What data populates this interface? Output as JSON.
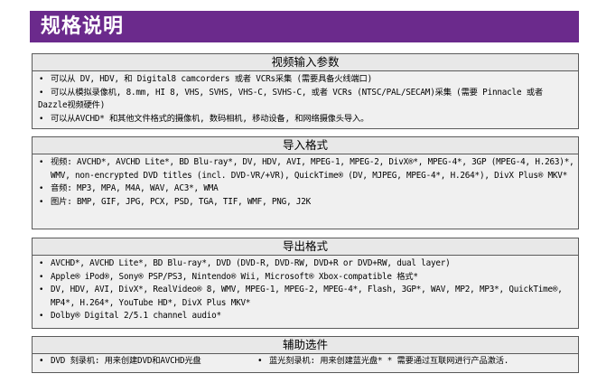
{
  "header": {
    "title": "规格说明",
    "bg_color": "#6b2a8c"
  },
  "sections": [
    {
      "title": "视频输入参数",
      "items": [
        "可以从 DV, HDV, 和 Digital8 camcorders 或者 VCRs采集 (需要具备火线端口)",
        "可以从模拟录像机, 8.mm, HI 8, VHS, SVHS, VHS-C, SVHS-C, 或者 VCRs (NTSC/PAL/SECAM)采集 (需要 Pinnacle 或者 Dazzle视频硬件)",
        "可以从AVCHD* 和其他文件格式的摄像机, 数码相机, 移动设备, 和网络摄像头导入。"
      ]
    },
    {
      "title": "导入格式",
      "items": [
        "视频: AVCHD*, AVCHD Lite*, BD Blu-ray*, DV, HDV, AVI, MPEG-1, MPEG-2, DivX®*, MPEG-4*, 3GP (MPEG-4, H.263)*, WMV, non-encrypted DVD titles (incl. DVD-VR/+VR), QuickTime® (DV, MJPEG, MPEG-4*, H.264*), DivX Plus® MKV*",
        "音频: MP3, MPA, M4A, WAV, AC3*, WMA",
        "图片: BMP, GIF, JPG, PCX, PSD, TGA, TIF, WMF, PNG, J2K"
      ]
    },
    {
      "title": "导出格式",
      "items": [
        "AVCHD*, AVCHD Lite*, BD Blu-ray*, DVD (DVD-R, DVD-RW, DVD+R or DVD+RW, dual layer)",
        "Apple® iPod®, Sony® PSP/PS3, Nintendo® Wii, Microsoft® Xbox-compatible 格式*",
        "DV, HDV, AVI, DivX*, RealVideo® 8, WMV, MPEG-1, MPEG-2, MPEG-4*, Flash, 3GP*, WAV, MP2, MP3*, QuickTime®, MP4*, H.264*, YouTube HD*, DivX Plus MKV*",
        "Dolby® Digital 2/5.1 channel audio*"
      ]
    },
    {
      "title": "辅助选件",
      "items": [
        "DVD 刻录机: 用来创建DVD和AVCHD光盘",
        "蓝光刻录机: 用来创建蓝光盘* * 需要通过互联网进行产品激活."
      ]
    }
  ]
}
